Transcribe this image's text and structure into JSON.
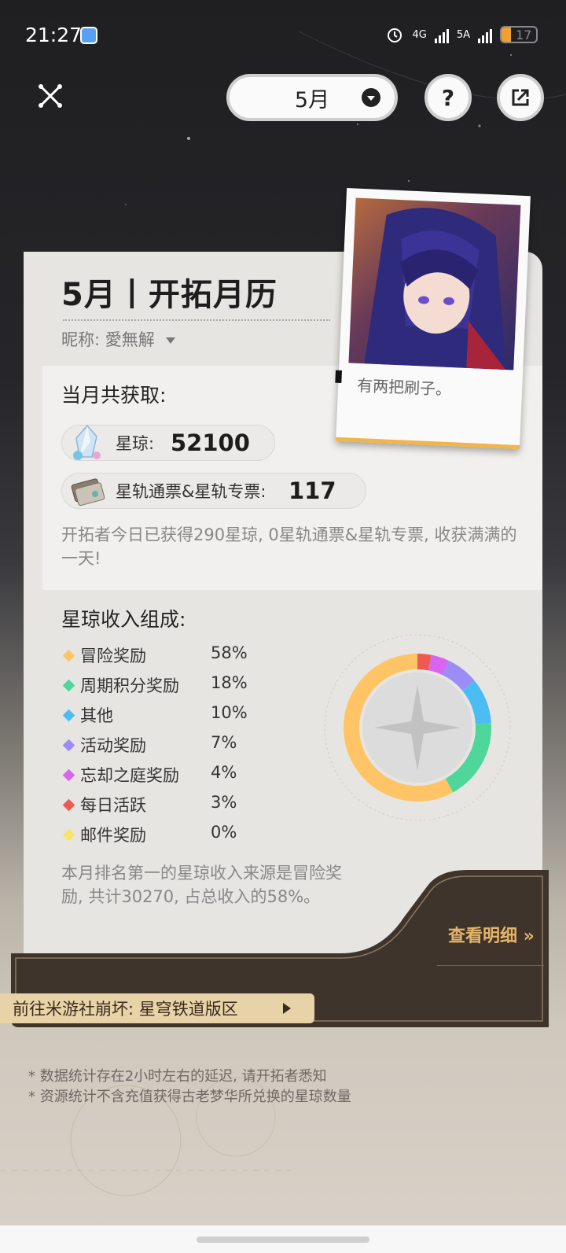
{
  "status_bar": {
    "time": "21:27",
    "battery": "17",
    "net1": "4G",
    "net2": "5A"
  },
  "header": {
    "month_select_value": "5月",
    "help_label": "?"
  },
  "card": {
    "title": "5月丨开拓月历",
    "nickname_label": "昵称:",
    "nickname_value": "愛無解",
    "photo_caption": "有两把刷子。"
  },
  "earned": {
    "title": "当月共获取:",
    "jade_label": "星琼:",
    "jade_value": "52100",
    "pass_label": "星轨通票&星轨专票:",
    "pass_value": "117",
    "note": "开拓者今日已获得290星琼, 0星轨通票&星轨专票, 收获满满的一天!"
  },
  "composition": {
    "title": "星琼收入组成:",
    "items": [
      {
        "name": "冒险奖励",
        "pct": "58%",
        "color": "#ffc465"
      },
      {
        "name": "周期积分奖励",
        "pct": "18%",
        "color": "#4fd69a"
      },
      {
        "name": "其他",
        "pct": "10%",
        "color": "#4cbdf2"
      },
      {
        "name": "活动奖励",
        "pct": "7%",
        "color": "#9b8cf6"
      },
      {
        "name": "忘却之庭奖励",
        "pct": "4%",
        "color": "#d765ef"
      },
      {
        "name": "每日活跃",
        "pct": "3%",
        "color": "#ec5a52"
      },
      {
        "name": "邮件奖励",
        "pct": "0%",
        "color": "#f6e46a"
      }
    ],
    "summary": "本月排名第一的星琼收入来源是冒险奖励, 共计30270, 占总收入的58%。"
  },
  "chart_data": {
    "type": "pie",
    "categories": [
      "冒险奖励",
      "周期积分奖励",
      "其他",
      "活动奖励",
      "忘却之庭奖励",
      "每日活跃",
      "邮件奖励"
    ],
    "values": [
      58,
      18,
      10,
      7,
      4,
      3,
      0
    ],
    "colors": [
      "#ffc465",
      "#4fd69a",
      "#4cbdf2",
      "#9b8cf6",
      "#d765ef",
      "#ec5a52",
      "#f6e46a"
    ]
  },
  "actions": {
    "detail_label": "查看明细 »",
    "forum_label": "前往米游社崩坏: 星穹铁道版区"
  },
  "footnotes": [
    "* 数据统计存在2小时左右的延迟, 请开拓者悉知",
    "* 资源统计不含充值获得古老梦华所兑换的星琼数量"
  ]
}
